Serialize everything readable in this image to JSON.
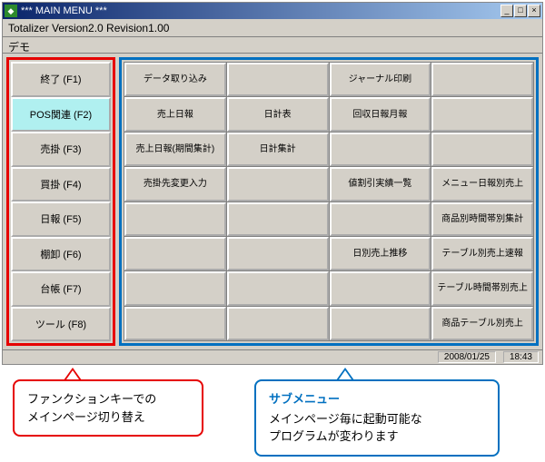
{
  "window": {
    "title": "***  MAIN MENU  ***",
    "subtitle": "Totalizer Version2.0 Revision1.00",
    "demo_label": "デモ"
  },
  "func_keys": [
    {
      "label": "終了 (F1)",
      "active": false
    },
    {
      "label": "POS関連 (F2)",
      "active": true
    },
    {
      "label": "売掛 (F3)",
      "active": false
    },
    {
      "label": "買掛 (F4)",
      "active": false
    },
    {
      "label": "日報 (F5)",
      "active": false
    },
    {
      "label": "棚卸 (F6)",
      "active": false
    },
    {
      "label": "台帳 (F7)",
      "active": false
    },
    {
      "label": "ツール (F8)",
      "active": false
    }
  ],
  "grid": [
    [
      "データ取り込み",
      "",
      "ジャーナル印刷",
      ""
    ],
    [
      "売上日報",
      "日計表",
      "回収日報月報",
      ""
    ],
    [
      "売上日報(期間集計)",
      "日計集計",
      "",
      ""
    ],
    [
      "売掛先変更入力",
      "",
      "値割引実績一覧",
      "メニュー日報別売上"
    ],
    [
      "",
      "",
      "",
      "商品別時間帯別集計"
    ],
    [
      "",
      "",
      "日別売上推移",
      "テーブル別売上速報"
    ],
    [
      "",
      "",
      "",
      "テーブル時間帯別売上"
    ],
    [
      "",
      "",
      "",
      "商品テーブル別売上"
    ]
  ],
  "status": {
    "date": "2008/01/25",
    "time": "18:43"
  },
  "callouts": {
    "red": "ファンクションキーでの\nメインページ切り替え",
    "blue_hdr": "サブメニュー",
    "blue_body": "メインページ毎に起動可能な\nプログラムが変わります"
  }
}
